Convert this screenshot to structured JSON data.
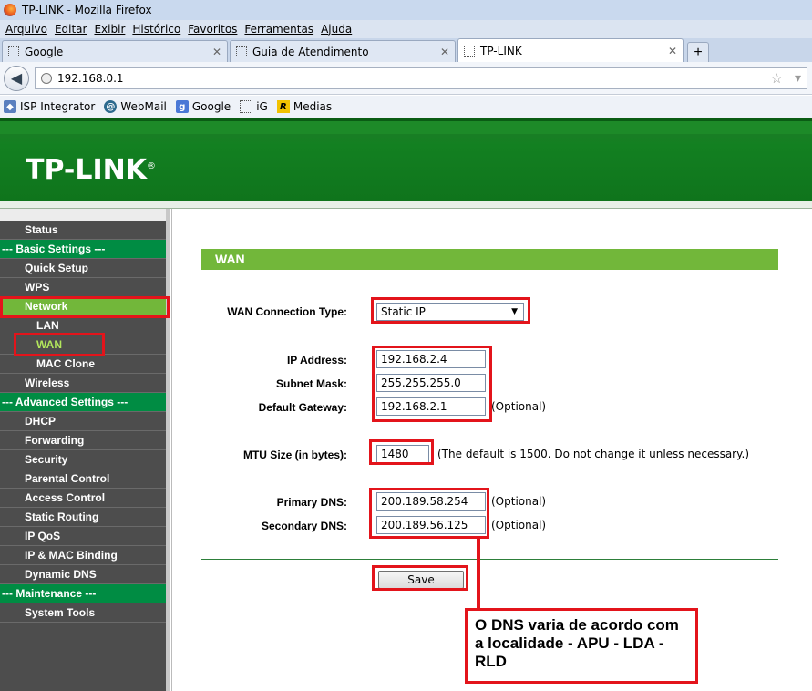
{
  "browser": {
    "window_title": "TP-LINK - Mozilla Firefox",
    "menu": [
      "Arquivo",
      "Editar",
      "Exibir",
      "Histórico",
      "Favoritos",
      "Ferramentas",
      "Ajuda"
    ],
    "tabs": [
      {
        "label": "Google"
      },
      {
        "label": "Guia de Atendimento"
      },
      {
        "label": "TP-LINK"
      }
    ],
    "new_tab_symbol": "+",
    "url": "192.168.0.1",
    "bookmarks": [
      {
        "label": "ISP Integrator",
        "icon": "isp-icon"
      },
      {
        "label": "WebMail",
        "icon": "webmail-icon"
      },
      {
        "label": "Google",
        "icon": "google-icon"
      },
      {
        "label": "iG",
        "icon": "ig-icon"
      },
      {
        "label": "Medias",
        "icon": "medias-icon"
      }
    ]
  },
  "router": {
    "brand": "TP-LINK",
    "brand_mark": "®",
    "menu": [
      {
        "label": "Status",
        "kind": "item"
      },
      {
        "label": "--- Basic Settings ---",
        "kind": "section"
      },
      {
        "label": "Quick Setup",
        "kind": "item"
      },
      {
        "label": "WPS",
        "kind": "item"
      },
      {
        "label": "Network",
        "kind": "item"
      },
      {
        "label": "LAN",
        "kind": "sub"
      },
      {
        "label": "WAN",
        "kind": "sub"
      },
      {
        "label": "MAC Clone",
        "kind": "sub"
      },
      {
        "label": "Wireless",
        "kind": "item"
      },
      {
        "label": "--- Advanced Settings ---",
        "kind": "section"
      },
      {
        "label": "DHCP",
        "kind": "item"
      },
      {
        "label": "Forwarding",
        "kind": "item"
      },
      {
        "label": "Security",
        "kind": "item"
      },
      {
        "label": "Parental Control",
        "kind": "item"
      },
      {
        "label": "Access Control",
        "kind": "item"
      },
      {
        "label": "Static Routing",
        "kind": "item"
      },
      {
        "label": "IP QoS",
        "kind": "item"
      },
      {
        "label": "IP & MAC Binding",
        "kind": "item"
      },
      {
        "label": "Dynamic DNS",
        "kind": "item"
      },
      {
        "label": "--- Maintenance ---",
        "kind": "section"
      },
      {
        "label": "System Tools",
        "kind": "item"
      }
    ],
    "page_title": "WAN",
    "form": {
      "conn_type_label": "WAN Connection Type:",
      "conn_type_value": "Static IP",
      "ip_label": "IP Address:",
      "ip_value": "192.168.2.4",
      "mask_label": "Subnet Mask:",
      "mask_value": "255.255.255.0",
      "gateway_label": "Default Gateway:",
      "gateway_value": "192.168.2.1",
      "optional": "(Optional)",
      "mtu_label": "MTU Size (in bytes):",
      "mtu_value": "1480",
      "mtu_note": "(The default is 1500. Do not change it unless necessary.)",
      "dns1_label": "Primary DNS:",
      "dns1_value": "200.189.58.254",
      "dns2_label": "Secondary DNS:",
      "dns2_value": "200.189.56.125",
      "save_label": "Save"
    }
  },
  "annotation": {
    "callout_text": "O DNS varia de acordo com a localidade - APU - LDA - RLD",
    "color": "#e3141b"
  }
}
